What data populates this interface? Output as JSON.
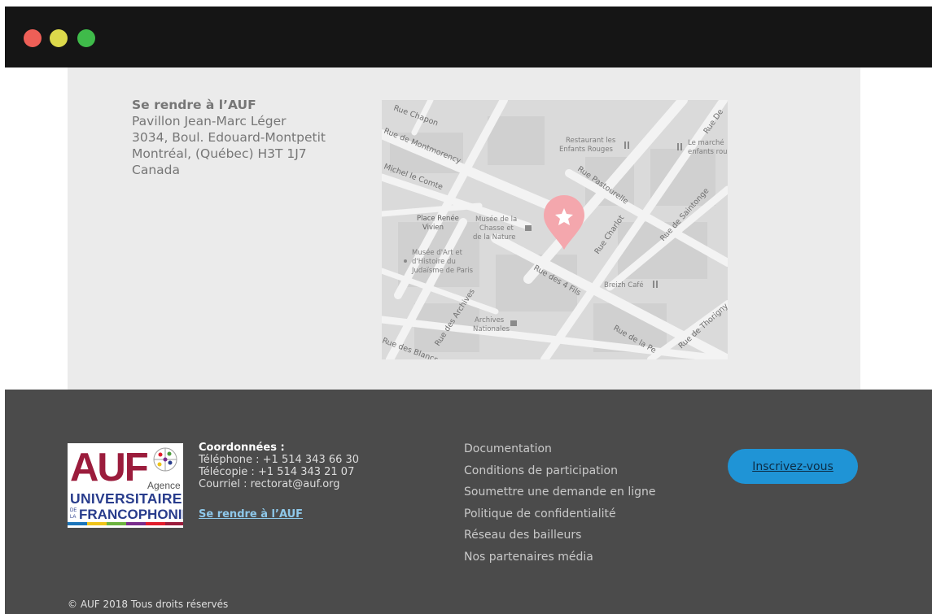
{
  "window": {
    "controls": [
      "close",
      "minimize",
      "maximize"
    ]
  },
  "address": {
    "title": "Se rendre à l’AUF",
    "line1": "Pavillon Jean-Marc Léger",
    "line2": "3034, Boul. Edouard-Montpetit",
    "line3": "Montréal, (Québec) H3T 1J7",
    "line4": "Canada"
  },
  "map": {
    "streets": [
      "Rue Chapon",
      "Rue de Montmorency",
      "Michel le Comte",
      "Rue Pastourelle",
      "Rue Charlot",
      "Rue de Saintonge",
      "Rue des 4 Fils",
      "Rue des Archives",
      "Rue de Thorigny",
      "Rue de la Pe",
      "Rue des Blancs",
      "Rue De"
    ],
    "places": [
      "Restaurant les",
      "Enfants Rouges",
      "Le marché",
      "enfants rou",
      "Place Renée",
      "Vivien",
      "Musée de la",
      "Chasse et",
      "de la Nature",
      "Musée d'Art et",
      "d'Histoire du",
      "Judaïsme de Paris",
      "Breizh Café",
      "Archives",
      "Nationales"
    ],
    "marker_icon": "star-icon",
    "marker_color": "#f4a7ad"
  },
  "footer": {
    "logo": {
      "text_top": "AUF",
      "text_agence": "Agence",
      "text_mid": "UNIVERSITAIRE",
      "text_de": "DE",
      "text_la": "LA",
      "text_bottom": "FRANCOPHONIE"
    },
    "contact": {
      "title": "Coordonnées :",
      "phone": "Téléphone : +1 514 343 66 30",
      "fax": "Télécopie : +1 514 343 21 07",
      "email": "Courriel : rectorat@auf.org",
      "link": "Se rendre à l’AUF"
    },
    "links": [
      "Documentation",
      "Conditions de participation",
      "Soumettre une demande en ligne",
      "Politique de confidentialité",
      "Réseau des bailleurs",
      "Nos partenaires média"
    ],
    "subscribe": "Inscrivez-vous",
    "copyright": "© AUF 2018 Tous droits réservés"
  },
  "colors": {
    "titlebar": "#151515",
    "content_bg": "#ebebeb",
    "footer_bg": "#4b4b4b",
    "accent": "#1f94d6",
    "link": "#8ec8ea"
  }
}
